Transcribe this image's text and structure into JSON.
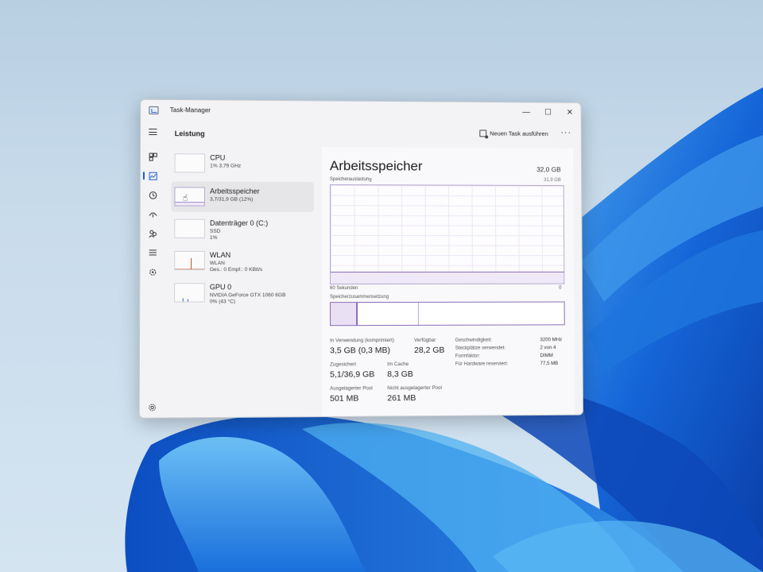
{
  "window": {
    "title": "Task-Manager",
    "controls": {
      "minimize": "—",
      "maximize": "☐",
      "close": "✕"
    }
  },
  "header": {
    "section_title": "Leistung",
    "run_task_label": "Neuen Task ausführen",
    "more_label": "···"
  },
  "nav_icons": [
    "hamburger-icon",
    "processes-icon",
    "performance-icon",
    "app-history-icon",
    "startup-icon",
    "users-icon",
    "details-icon",
    "services-icon",
    "settings-icon"
  ],
  "devices": [
    {
      "name": "CPU",
      "line1": "1%  3,79 GHz",
      "line2": ""
    },
    {
      "name": "Arbeitsspeicher",
      "line1": "3,7/31,9 GB (12%)",
      "line2": ""
    },
    {
      "name": "Datenträger 0 (C:)",
      "line1": "SSD",
      "line2": "1%"
    },
    {
      "name": "WLAN",
      "line1": "WLAN",
      "line2": "Ges.: 0 Empf.: 0 KBit/s"
    },
    {
      "name": "GPU 0",
      "line1": "NVIDIA GeForce GTX 1060 6GB",
      "line2": "0%  (43 °C)"
    }
  ],
  "detail": {
    "title": "Arbeitsspeicher",
    "total": "32,0 GB",
    "graph_label": "Speicherauslastung",
    "graph_max": "31,9 GB",
    "usage_fraction": 0.12,
    "axis_left": "60 Sekunden",
    "axis_right": "0",
    "composition_label": "Speicherzusammensetzung",
    "stats": {
      "in_use_label": "In Verwendung (komprimiert)",
      "in_use_value": "3,5 GB (0,3 MB)",
      "available_label": "Verfügbar",
      "available_value": "28,2 GB",
      "committed_label": "Zugesichert",
      "committed_value": "5,1/36,9 GB",
      "cached_label": "Im Cache",
      "cached_value": "8,3 GB",
      "paged_label": "Ausgelagerter Pool",
      "paged_value": "501 MB",
      "nonpaged_label": "Nicht ausgelagerter Pool",
      "nonpaged_value": "261 MB"
    },
    "specs": [
      {
        "label": "Geschwindigkeit:",
        "value": "3200 MHz"
      },
      {
        "label": "Steckplätze verwendet:",
        "value": "2 von 4"
      },
      {
        "label": "Formfaktor:",
        "value": "DIMM"
      },
      {
        "label": "Für Hardware reserviert:",
        "value": "77,5 MB"
      }
    ]
  },
  "colors": {
    "accent": "#1a5fc9",
    "memory_line": "#8a6db5",
    "wallpaper_blue": "#1565d8"
  }
}
